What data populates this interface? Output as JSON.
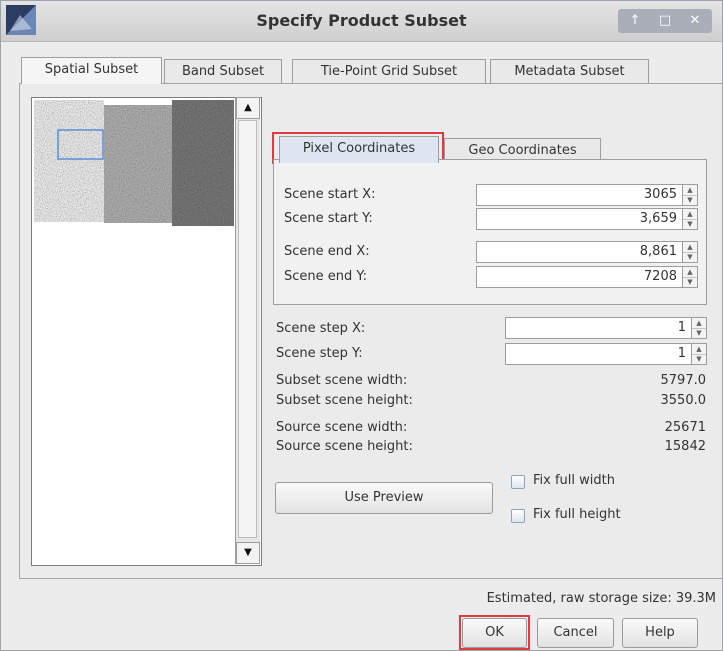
{
  "window": {
    "title": "Specify Product Subset"
  },
  "tabs": [
    "Spatial Subset",
    "Band Subset",
    "Tie-Point Grid Subset",
    "Metadata Subset"
  ],
  "subtabs": [
    "Pixel Coordinates",
    "Geo Coordinates"
  ],
  "scene": {
    "start_x_label": "Scene start X:",
    "start_x": "3065",
    "start_y_label": "Scene start Y:",
    "start_y": "3,659",
    "end_x_label": "Scene end X:",
    "end_x": "8,861",
    "end_y_label": "Scene end Y:",
    "end_y": "7208",
    "step_x_label": "Scene step X:",
    "step_x": "1",
    "step_y_label": "Scene step Y:",
    "step_y": "1"
  },
  "info": {
    "subset_width_label": "Subset scene width:",
    "subset_width": "5797.0",
    "subset_height_label": "Subset scene height:",
    "subset_height": "3550.0",
    "source_width_label": "Source scene width:",
    "source_width": "25671",
    "source_height_label": "Source scene height:",
    "source_height": "15842"
  },
  "buttons": {
    "use_preview": "Use Preview",
    "ok": "OK",
    "cancel": "Cancel",
    "help": "Help"
  },
  "checkboxes": {
    "fix_width": "Fix full width",
    "fix_height": "Fix full height"
  },
  "storage": "Estimated, raw storage size: 39.3M",
  "highlight_color": "#e03a43",
  "icons": [
    "app-icon",
    "pin-icon",
    "maximize-icon",
    "close-icon",
    "scroll-up-icon",
    "scroll-down-icon",
    "spin-up-icon",
    "spin-down-icon"
  ]
}
